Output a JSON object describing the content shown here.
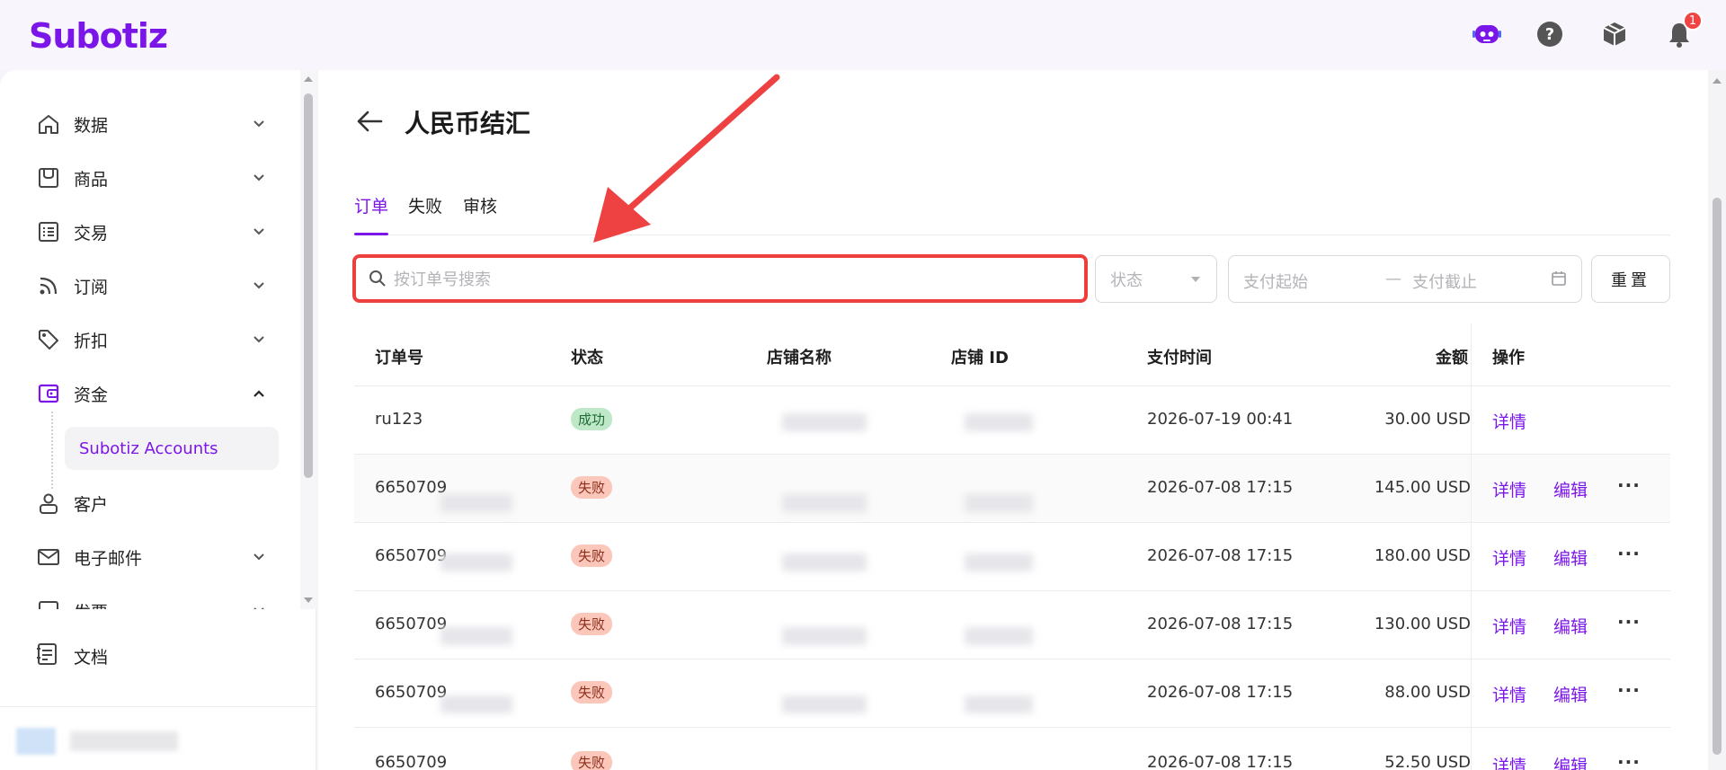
{
  "app": {
    "logo": "Subotiz",
    "notification_count": "1"
  },
  "sidebar": {
    "items": [
      {
        "label": "数据",
        "icon": "home-icon",
        "expanded": false
      },
      {
        "label": "商品",
        "icon": "store-icon",
        "expanded": false
      },
      {
        "label": "交易",
        "icon": "list-icon",
        "expanded": false
      },
      {
        "label": "订阅",
        "icon": "rss-icon",
        "expanded": false
      },
      {
        "label": "折扣",
        "icon": "tag-icon",
        "expanded": false
      },
      {
        "label": "资金",
        "icon": "wallet-icon",
        "expanded": true
      },
      {
        "label": "客户",
        "icon": "user-icon",
        "expanded": false
      },
      {
        "label": "电子邮件",
        "icon": "mail-icon",
        "expanded": false
      },
      {
        "label": "发票",
        "icon": "invoice-icon",
        "expanded": false
      }
    ],
    "sub_item": "Subotiz Accounts",
    "docs_label": "文档"
  },
  "page": {
    "title": "人民币结汇",
    "tabs": [
      "订单",
      "失败",
      "审核"
    ],
    "active_tab": 0
  },
  "filters": {
    "search_placeholder": "按订单号搜索",
    "status_placeholder": "状态",
    "date_start_placeholder": "支付起始",
    "date_sep": "—",
    "date_end_placeholder": "支付截止",
    "reset_label": "重置"
  },
  "table": {
    "columns": [
      "订单号",
      "状态",
      "店铺名称",
      "店铺 ID",
      "支付时间",
      "金额",
      "操作"
    ],
    "rows": [
      {
        "order": "ru123",
        "status": "成功",
        "status_type": "ok",
        "time": "2026-07-19 00:41",
        "amount": "30.00 USD",
        "actions": [
          "详情"
        ]
      },
      {
        "order": "6650709",
        "status": "失败",
        "status_type": "fail",
        "time": "2026-07-08 17:15",
        "amount": "145.00 USD",
        "actions": [
          "详情",
          "编辑"
        ]
      },
      {
        "order": "6650709",
        "status": "失败",
        "status_type": "fail",
        "time": "2026-07-08 17:15",
        "amount": "180.00 USD",
        "actions": [
          "详情",
          "编辑"
        ]
      },
      {
        "order": "6650709",
        "status": "失败",
        "status_type": "fail",
        "time": "2026-07-08 17:15",
        "amount": "130.00 USD",
        "actions": [
          "详情",
          "编辑"
        ]
      },
      {
        "order": "6650709",
        "status": "失败",
        "status_type": "fail",
        "time": "2026-07-08 17:15",
        "amount": "88.00 USD",
        "actions": [
          "详情",
          "编辑"
        ]
      },
      {
        "order": "6650709",
        "status": "失败",
        "status_type": "fail",
        "time": "2026-07-08 17:15",
        "amount": "52.50 USD",
        "actions": [
          "详情",
          "编辑"
        ]
      }
    ]
  },
  "colors": {
    "brand": "#7b16e8",
    "highlight": "#ee3f3f"
  }
}
